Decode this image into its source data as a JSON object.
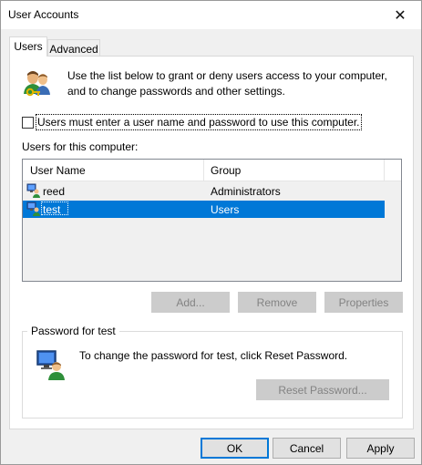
{
  "window": {
    "title": "User Accounts",
    "close_glyph": "✕"
  },
  "tabs": [
    {
      "label": "Users",
      "active": true
    },
    {
      "label": "Advanced",
      "active": false
    }
  ],
  "users_tab": {
    "intro": "Use the list below to grant or deny users access to your computer, and to change passwords and other settings.",
    "require_login_checkbox": {
      "label": "Users must enter a user name and password to use this computer.",
      "checked": false
    },
    "users_list_label": "Users for this computer:",
    "columns": [
      "User Name",
      "Group"
    ],
    "users": [
      {
        "name": "reed",
        "group": "Administrators",
        "selected": false
      },
      {
        "name": "test",
        "group": "Users",
        "selected": true
      }
    ],
    "buttons": {
      "add": "Add...",
      "remove": "Remove",
      "properties": "Properties"
    },
    "password_group": {
      "title": "Password for test",
      "text": "To change the password for test, click Reset Password.",
      "reset_button": "Reset Password..."
    }
  },
  "footer": {
    "ok": "OK",
    "cancel": "Cancel",
    "apply": "Apply"
  },
  "colors": {
    "selection": "#0078d7",
    "window_bg": "#f0f0f0",
    "panel_bg": "#ffffff"
  }
}
